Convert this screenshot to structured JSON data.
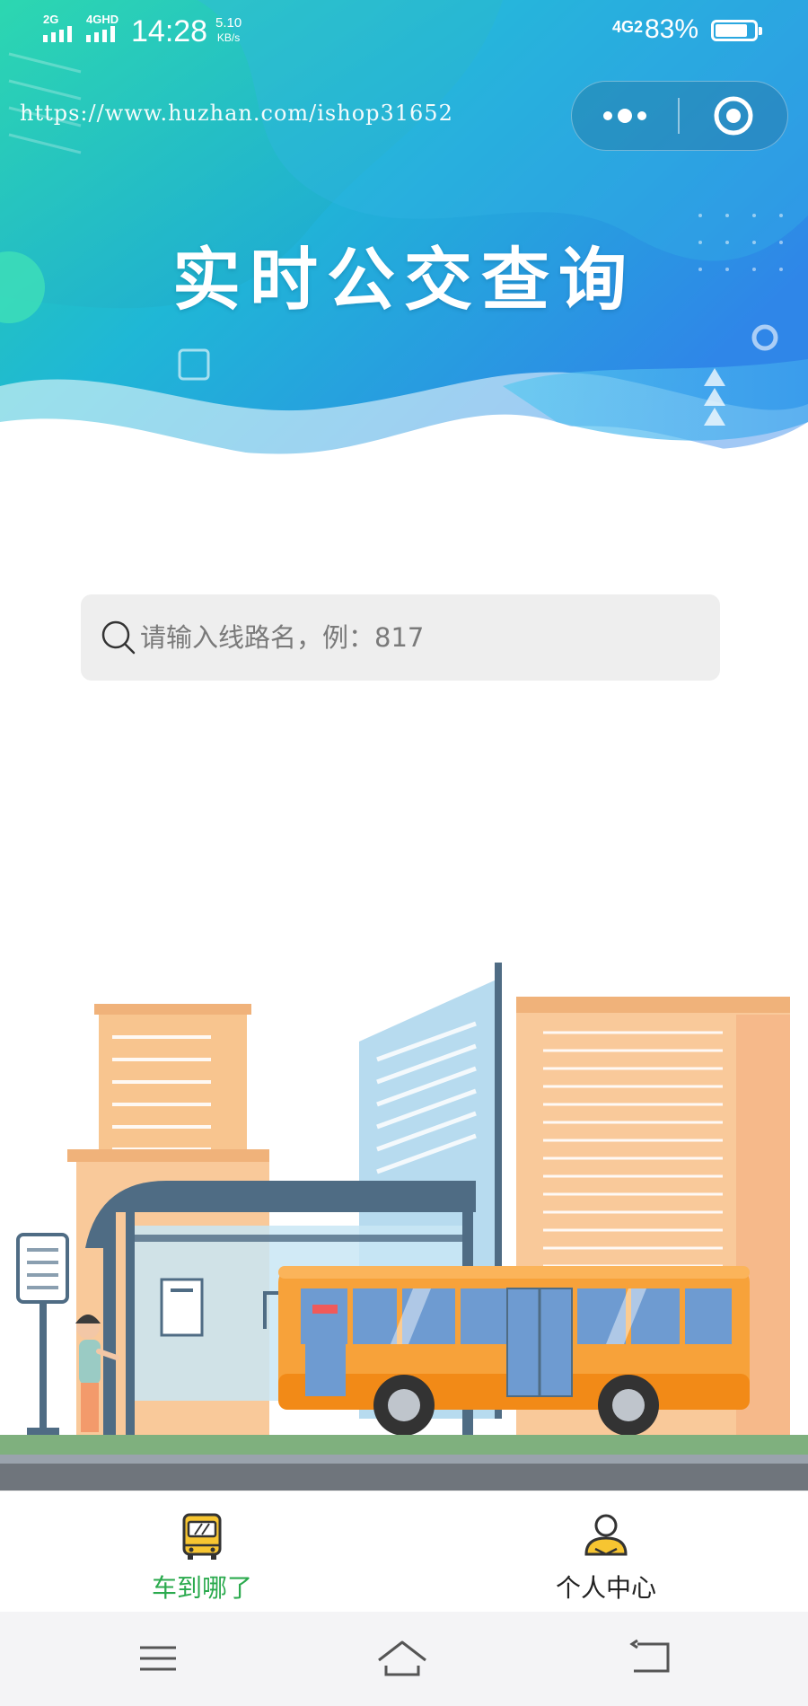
{
  "status_bar": {
    "signal_1_label": "2G",
    "signal_2_label": "4GHD",
    "time": "14:28",
    "speed_value": "5.10",
    "speed_unit": "KB/s",
    "network_label": "4G2",
    "battery_percent": "83%",
    "battery_level": 0.83
  },
  "watermark": "https://www.huzhan.com/ishop31652",
  "capsule": {
    "more_icon": "more-dots-icon",
    "close_icon": "target-circle-icon"
  },
  "header": {
    "title": "实时公交查询"
  },
  "search": {
    "placeholder": "请输入线路名，例：817",
    "value": "",
    "icon": "search-icon"
  },
  "tabbar": {
    "items": [
      {
        "label": "车到哪了",
        "icon": "bus-icon",
        "active": true,
        "color": "#2BAA4E"
      },
      {
        "label": "个人中心",
        "icon": "user-icon",
        "active": false,
        "color": "#222222"
      }
    ]
  },
  "sysnav": {
    "menu_icon": "menu-icon",
    "home_icon": "home-icon",
    "back_icon": "back-icon"
  },
  "colors": {
    "hero_start": "#23C8A8",
    "hero_end": "#2F8FE6",
    "tab_active": "#2BAA4E",
    "search_bg": "#EEEEEE"
  }
}
